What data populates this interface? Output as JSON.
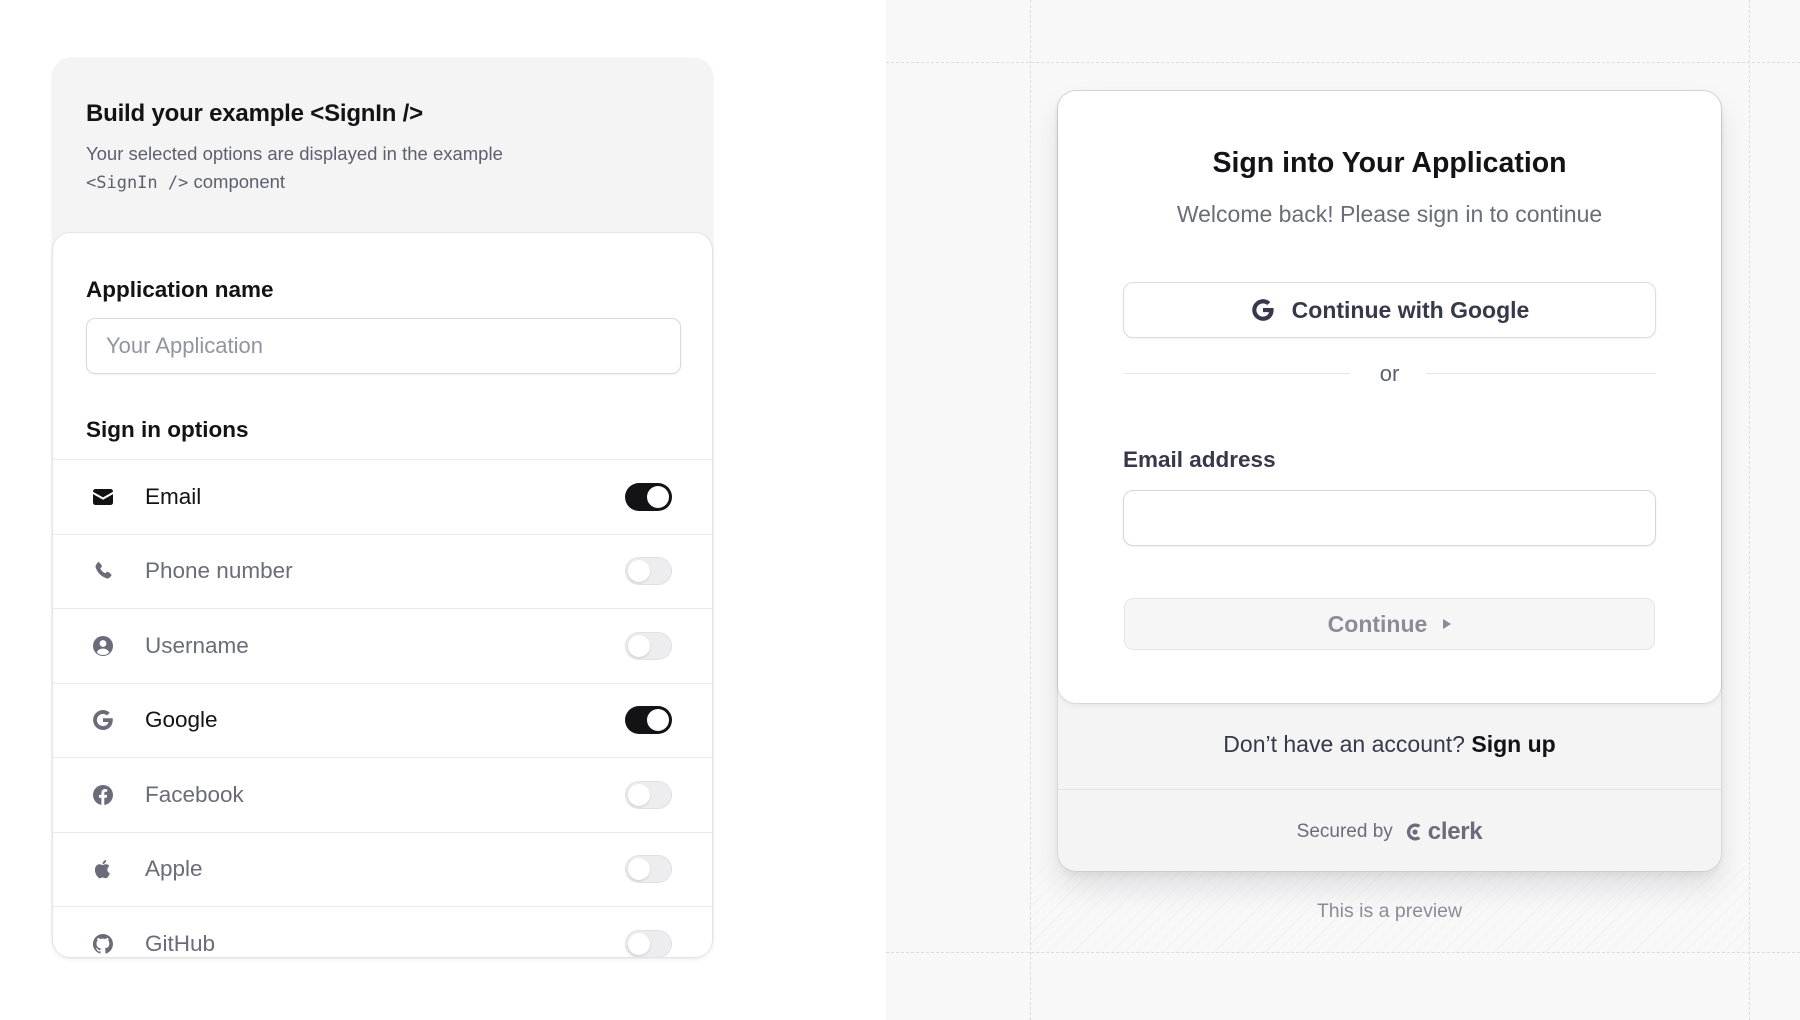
{
  "builder": {
    "title": "Build your example <SignIn />",
    "description_prefix": "Your selected options are displayed in the example",
    "description_code": "<SignIn />",
    "description_suffix": "component",
    "app_name_label": "Application name",
    "app_name_placeholder": "Your Application",
    "app_name_value": "",
    "sign_in_options_label": "Sign in options",
    "options": [
      {
        "label": "Email",
        "icon": "mail-icon",
        "enabled": true
      },
      {
        "label": "Phone number",
        "icon": "phone-icon",
        "enabled": false
      },
      {
        "label": "Username",
        "icon": "user-circle-icon",
        "enabled": false
      },
      {
        "label": "Google",
        "icon": "google-icon",
        "enabled": true
      },
      {
        "label": "Facebook",
        "icon": "facebook-icon",
        "enabled": false
      },
      {
        "label": "Apple",
        "icon": "apple-icon",
        "enabled": false
      },
      {
        "label": "GitHub",
        "icon": "github-icon",
        "enabled": false
      }
    ]
  },
  "preview": {
    "title": "Sign into Your Application",
    "subtitle": "Welcome back! Please sign in to continue",
    "google_button": "Continue with Google",
    "divider_text": "or",
    "email_label": "Email address",
    "email_value": "",
    "continue_button": "Continue",
    "signup_prompt": "Don’t have an account?",
    "signup_link": "Sign up",
    "secured_by": "Secured by",
    "brand": "clerk",
    "preview_note": "This is a preview"
  },
  "colors": {
    "toggle_on": "#131316",
    "toggle_off": "#ededf0",
    "text_primary": "#131316",
    "text_secondary": "#6b6c7a"
  }
}
